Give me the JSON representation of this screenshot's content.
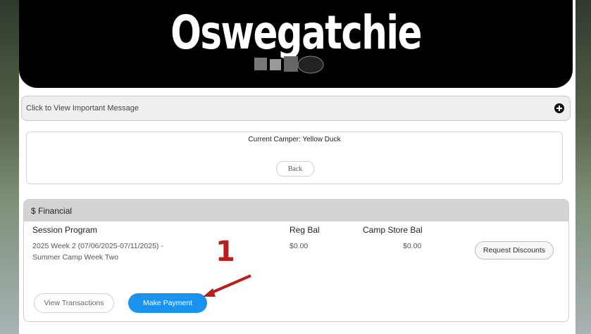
{
  "banner": {
    "title": "Oswegatchie"
  },
  "message_bar": {
    "text": "Click to View Important Message",
    "icon": "plus-circle-icon"
  },
  "camper": {
    "label": "Current Camper: Yellow Duck",
    "back_label": "Back"
  },
  "financial": {
    "header": "$ Financial",
    "columns": {
      "program": "Session Program",
      "reg_bal": "Reg Bal",
      "store_bal": "Camp Store Bal"
    },
    "rows": [
      {
        "program_line1": "2025 Week 2 (07/06/2025-07/11/2025) -",
        "program_line2": "Summer Camp Week Two",
        "reg_bal": "$0.00",
        "store_bal": "$0.00"
      }
    ],
    "request_discounts_label": "Request Discounts",
    "view_transactions_label": "View Transactions",
    "make_payment_label": "Make Payment"
  },
  "annotation": {
    "number": "1",
    "color": "#b81f1f"
  },
  "colors": {
    "primary_button": "#1a93f0",
    "top_strip": "#1f6f3a"
  }
}
